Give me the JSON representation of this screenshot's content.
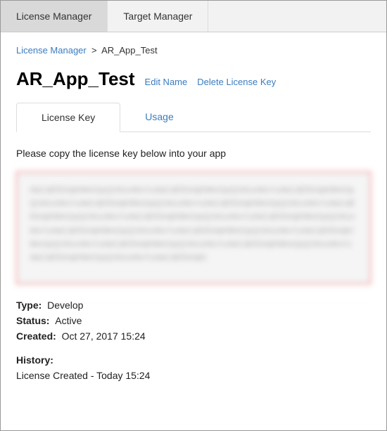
{
  "topTabs": {
    "licenseManager": "License Manager",
    "targetManager": "Target Manager"
  },
  "breadcrumb": {
    "root": "License Manager",
    "separator": ">",
    "current": "AR_App_Test"
  },
  "pageTitle": "AR_App_Test",
  "actions": {
    "editName": "Edit Name",
    "deleteKey": "Delete License Key"
  },
  "subTabs": {
    "licenseKey": "License Key",
    "usage": "Usage"
  },
  "instruction": "Please copy the license key below into your app",
  "licenseKeyText": "AbCdEfGhIjKlMnOpQrStUvWxYzAbCdEfGhIjKlMnOpQrStUvWxYzAbCdEfGhIjKlMnOpQrStUvWxYzAbCdEfGhIjKlMnOpQrStUvWxYzAbCdEfGhIjKlMnOpQrStUvWxYzAbCdEfGhIjKlMnOpQrStUvWxYzAbCdEfGhIjKlMnOpQrStUvWxYzAbCdEfGhIjKlMnOpQrStUvWxYzAbCdEfGhIjKlMnOpQrStUvWxYzAbCdEfGhIjKlMnOpQrStUvWxYzAbCdEfGhIjKlMnOpQrStUvWxYzAbCdEfGhIjKlMnOpQrStUvWxYzAbCdEfGhIjKlMnOpQrStUvWxYzAbCdEfGhIjKlMnOpQrStUvWxYzAbCdEfGhIjKl",
  "meta": {
    "typeLabel": "Type:",
    "typeValue": "Develop",
    "statusLabel": "Status:",
    "statusValue": "Active",
    "createdLabel": "Created:",
    "createdValue": "Oct 27, 2017 15:24"
  },
  "history": {
    "label": "History:",
    "entry": "License Created - Today 15:24"
  }
}
